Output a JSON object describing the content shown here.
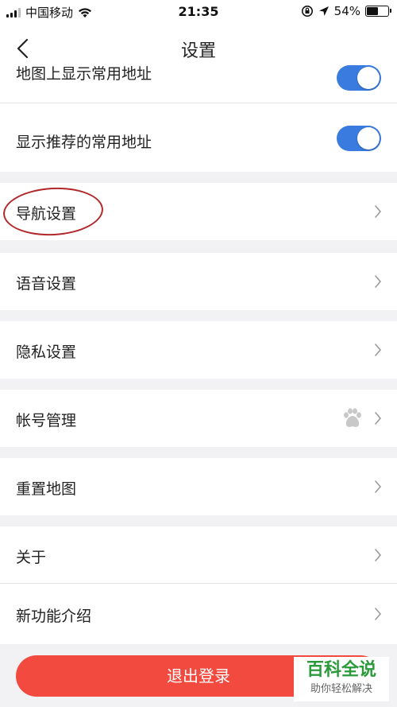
{
  "status_bar": {
    "carrier": "中国移动",
    "time": "21:35",
    "battery_percent": "54%",
    "battery_level": 0.54
  },
  "header": {
    "title": "设置"
  },
  "settings": {
    "partial_item_label": "地图上显示常用地址",
    "recommended_label": "显示推荐的常用地址",
    "items": [
      {
        "label": "导航设置"
      },
      {
        "label": "语音设置"
      },
      {
        "label": "隐私设置"
      },
      {
        "label": "帐号管理"
      },
      {
        "label": "重置地图"
      },
      {
        "label": "关于"
      },
      {
        "label": "新功能介绍"
      }
    ],
    "toggles": {
      "show_common_on_map": true,
      "show_recommended": true
    }
  },
  "footer": {
    "logout_label": "退出登录"
  },
  "watermark": {
    "main": "百科全说",
    "sub": "助你轻松解决"
  },
  "colors": {
    "toggle_on": "#3a7be0",
    "logout": "#f24a3f",
    "annotation": "#b1272a",
    "watermark": "#2a9a3b"
  }
}
